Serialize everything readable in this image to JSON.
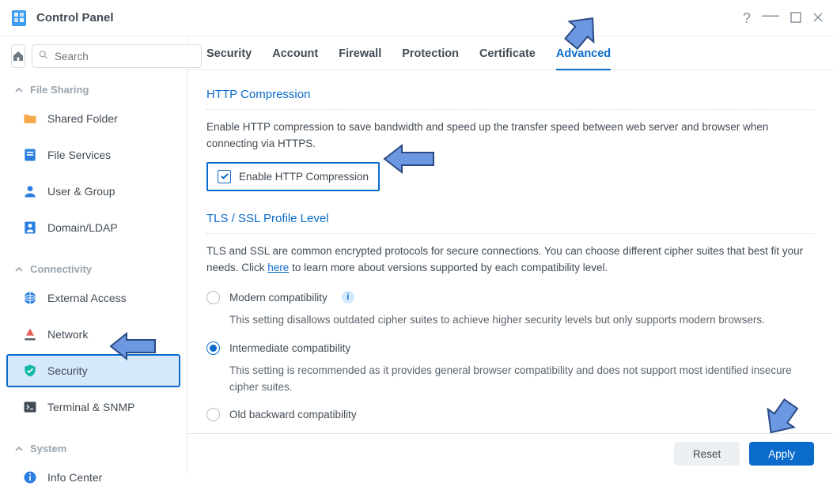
{
  "window": {
    "title": "Control Panel"
  },
  "search": {
    "placeholder": "Search"
  },
  "sidebar": {
    "groups": [
      {
        "label": "File Sharing"
      },
      {
        "label": "Connectivity"
      },
      {
        "label": "System"
      }
    ],
    "items": {
      "shared_folder": "Shared Folder",
      "file_services": "File Services",
      "user_group": "User & Group",
      "domain_ldap": "Domain/LDAP",
      "external_access": "External Access",
      "network": "Network",
      "security": "Security",
      "terminal_snmp": "Terminal & SNMP",
      "info_center": "Info Center"
    }
  },
  "tabs": {
    "security": "Security",
    "account": "Account",
    "firewall": "Firewall",
    "protection": "Protection",
    "certificate": "Certificate",
    "advanced": "Advanced"
  },
  "http_compression": {
    "title": "HTTP Compression",
    "desc": "Enable HTTP compression to save bandwidth and speed up the transfer speed between web server and browser when connecting via HTTPS.",
    "checkbox_label": "Enable HTTP Compression",
    "checked": true
  },
  "tls": {
    "title": "TLS / SSL Profile Level",
    "desc_pre": "TLS and SSL are common encrypted protocols for secure connections. You can choose different cipher suites that best fit your needs. Click ",
    "here": "here",
    "desc_post": " to learn more about versions supported by each compatibility level.",
    "options": [
      {
        "label": "Modern compatibility",
        "desc": "This setting disallows outdated cipher suites to achieve higher security levels but only supports modern browsers.",
        "has_info": true
      },
      {
        "label": "Intermediate compatibility",
        "desc": "This setting is recommended as it provides general browser compatibility and does not support most identified insecure cipher suites."
      },
      {
        "label": "Old backward compatibility"
      }
    ],
    "selected": 1
  },
  "footer": {
    "reset": "Reset",
    "apply": "Apply"
  },
  "info_glyph": "i"
}
